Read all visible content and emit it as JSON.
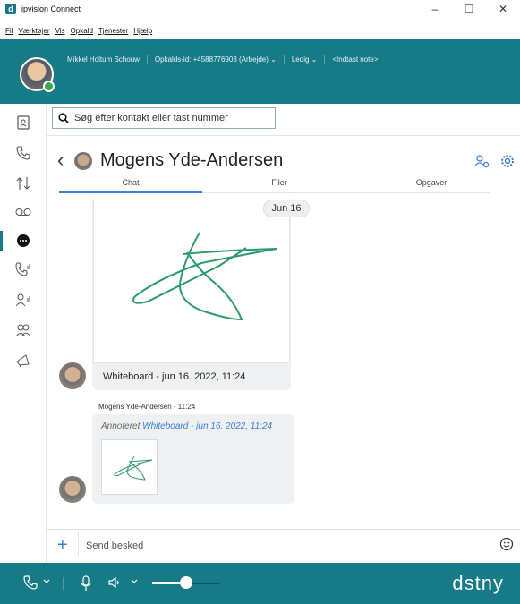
{
  "window": {
    "app_title": "ipvision Connect",
    "logo_letter": "d",
    "minimize": "–",
    "maximize": "☐",
    "close": "✕"
  },
  "menu": [
    "Fil",
    "Værktøjer",
    "Vis",
    "Opkald",
    "Tjenester",
    "Hjælp"
  ],
  "header": {
    "user_name": "Mikkel Holtum Schouw",
    "caller_id": "Opkalds-id: +4588776903 (Arbejde)",
    "status": "Ledig",
    "note_placeholder": "<Indtast note>"
  },
  "search": {
    "placeholder": "Søg efter kontakt eller tast nummer"
  },
  "conversation": {
    "contact_name": "Mogens Yde-Andersen",
    "tabs": [
      {
        "label": "Chat",
        "active": true
      },
      {
        "label": "Filer",
        "active": false
      },
      {
        "label": "Opgaver",
        "active": false
      }
    ],
    "date_chip": "Jun 16",
    "messages": [
      {
        "type": "whiteboard",
        "caption": "Whiteboard - jun 16. 2022, 11:24"
      },
      {
        "sender_line": "Mogens Yde-Andersen - 11:24",
        "annotated_prefix": "Annoteret",
        "annotated_link": "Whiteboard - jun 16. 2022, 11:24"
      }
    ]
  },
  "composer": {
    "placeholder": "Send besked"
  },
  "bottom": {
    "brand": "dstny",
    "volume_level": 0.5
  },
  "colors": {
    "accent": "#167a87",
    "link": "#3b7fd6",
    "ink": "#2e9a6b",
    "presence": "#3ca944"
  }
}
